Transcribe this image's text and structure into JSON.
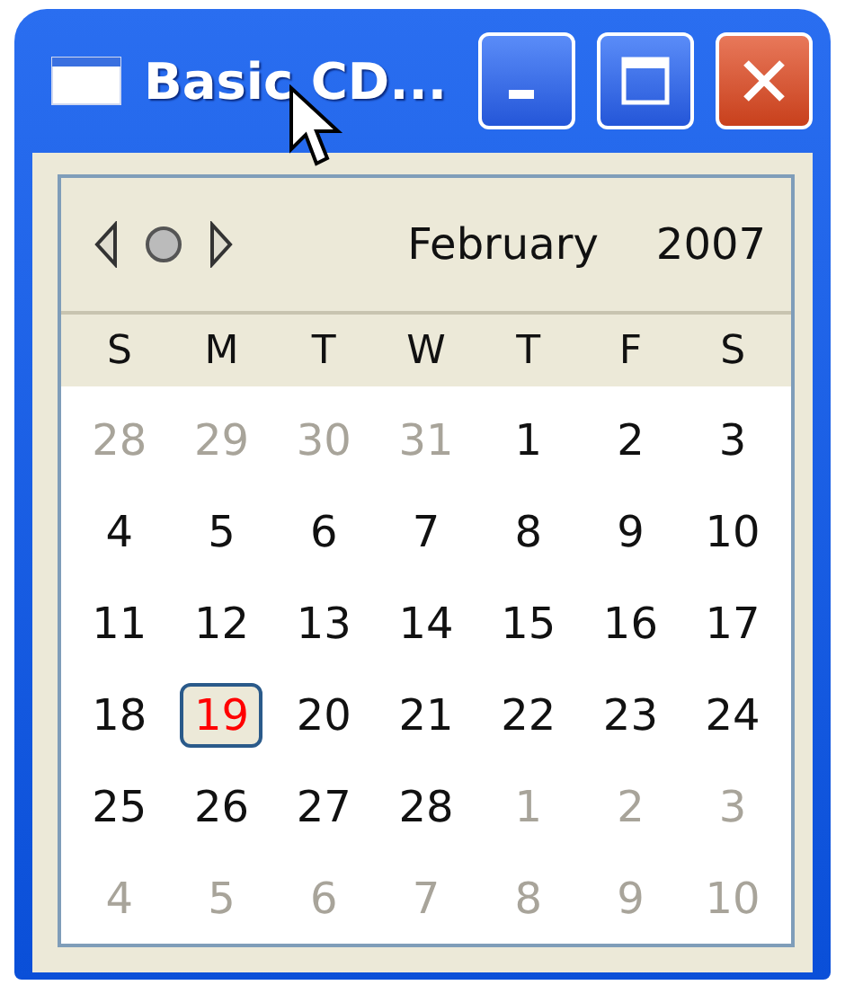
{
  "window": {
    "title": "Basic CD..."
  },
  "header": {
    "month": "February",
    "year": "2007"
  },
  "weekdays": [
    "S",
    "M",
    "T",
    "W",
    "T",
    "F",
    "S"
  ],
  "days": [
    {
      "label": "28",
      "in_month": false,
      "selected": false
    },
    {
      "label": "29",
      "in_month": false,
      "selected": false
    },
    {
      "label": "30",
      "in_month": false,
      "selected": false
    },
    {
      "label": "31",
      "in_month": false,
      "selected": false
    },
    {
      "label": "1",
      "in_month": true,
      "selected": false
    },
    {
      "label": "2",
      "in_month": true,
      "selected": false
    },
    {
      "label": "3",
      "in_month": true,
      "selected": false
    },
    {
      "label": "4",
      "in_month": true,
      "selected": false
    },
    {
      "label": "5",
      "in_month": true,
      "selected": false
    },
    {
      "label": "6",
      "in_month": true,
      "selected": false
    },
    {
      "label": "7",
      "in_month": true,
      "selected": false
    },
    {
      "label": "8",
      "in_month": true,
      "selected": false
    },
    {
      "label": "9",
      "in_month": true,
      "selected": false
    },
    {
      "label": "10",
      "in_month": true,
      "selected": false
    },
    {
      "label": "11",
      "in_month": true,
      "selected": false
    },
    {
      "label": "12",
      "in_month": true,
      "selected": false
    },
    {
      "label": "13",
      "in_month": true,
      "selected": false
    },
    {
      "label": "14",
      "in_month": true,
      "selected": false
    },
    {
      "label": "15",
      "in_month": true,
      "selected": false
    },
    {
      "label": "16",
      "in_month": true,
      "selected": false
    },
    {
      "label": "17",
      "in_month": true,
      "selected": false
    },
    {
      "label": "18",
      "in_month": true,
      "selected": false
    },
    {
      "label": "19",
      "in_month": true,
      "selected": true
    },
    {
      "label": "20",
      "in_month": true,
      "selected": false
    },
    {
      "label": "21",
      "in_month": true,
      "selected": false
    },
    {
      "label": "22",
      "in_month": true,
      "selected": false
    },
    {
      "label": "23",
      "in_month": true,
      "selected": false
    },
    {
      "label": "24",
      "in_month": true,
      "selected": false
    },
    {
      "label": "25",
      "in_month": true,
      "selected": false
    },
    {
      "label": "26",
      "in_month": true,
      "selected": false
    },
    {
      "label": "27",
      "in_month": true,
      "selected": false
    },
    {
      "label": "28",
      "in_month": true,
      "selected": false
    },
    {
      "label": "1",
      "in_month": false,
      "selected": false
    },
    {
      "label": "2",
      "in_month": false,
      "selected": false
    },
    {
      "label": "3",
      "in_month": false,
      "selected": false
    },
    {
      "label": "4",
      "in_month": false,
      "selected": false
    },
    {
      "label": "5",
      "in_month": false,
      "selected": false
    },
    {
      "label": "6",
      "in_month": false,
      "selected": false
    },
    {
      "label": "7",
      "in_month": false,
      "selected": false
    },
    {
      "label": "8",
      "in_month": false,
      "selected": false
    },
    {
      "label": "9",
      "in_month": false,
      "selected": false
    },
    {
      "label": "10",
      "in_month": false,
      "selected": false
    }
  ]
}
